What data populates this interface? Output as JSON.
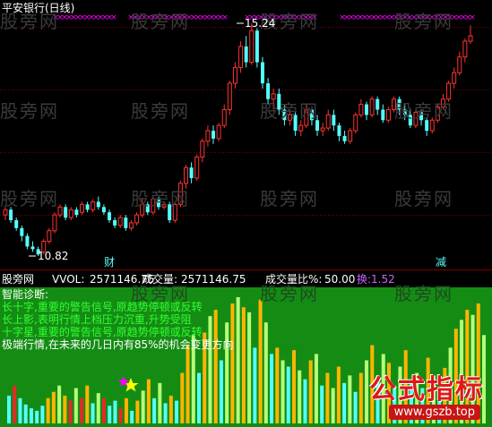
{
  "main_panel": {
    "title": "平安银行(日线)",
    "high_label": "15.24",
    "low_label": "10.82",
    "marker_cai": "财",
    "marker_jian": "减"
  },
  "volume_header": {
    "source": "股旁网",
    "vol_label": "VVOL:",
    "vol_value": "2571146.75",
    "cjl_label": "成交量:",
    "cjl_value": "2571146.75",
    "ratio_label": "成交量比%:",
    "ratio_value": "50.00",
    "huan_label": "换:",
    "huan_value": "1.52"
  },
  "diagnosis": {
    "title": "智能诊断:",
    "lines": [
      "长十字,重要的警告信号,原趋势停顿或反转",
      "长上影,表明行情上档压力沉重,升势受阻",
      "十字星,重要的警告信号,原趋势停顿或反转",
      "极端行情,在未来的几日内有85%的机会变更方向"
    ]
  },
  "watermark": "股旁网",
  "logo": {
    "text": "公式指标",
    "url": "www.gszb.top"
  },
  "colors": {
    "up": "#ff3232",
    "down": "#54ffff",
    "grid": "#7a0000",
    "marker_x": "#ff00ff",
    "vol_bg": "#148c14",
    "vol_up": "#ffb400",
    "vol_light": "#b4ff78",
    "vol_down": "#54ffff",
    "vol_red": "#e62828",
    "diag_green": "#32ff32",
    "purple": "#c864ff"
  },
  "chart_data": {
    "type": "candlestick",
    "symbol": "平安银行",
    "period": "日线",
    "max_price": 15.24,
    "min_price": 10.82,
    "candles": [
      [
        11.6,
        11.7,
        11.75,
        11.5
      ],
      [
        11.7,
        11.5,
        11.75,
        11.45
      ],
      [
        11.5,
        11.35,
        11.55,
        11.3
      ],
      [
        11.35,
        11.2,
        11.4,
        11.1
      ],
      [
        11.2,
        11.0,
        11.25,
        10.95
      ],
      [
        11.0,
        10.95,
        11.1,
        10.9
      ],
      [
        10.95,
        10.85,
        11.0,
        10.82
      ],
      [
        10.9,
        11.1,
        11.15,
        10.85
      ],
      [
        11.1,
        11.3,
        11.35,
        11.05
      ],
      [
        11.3,
        11.6,
        11.65,
        11.25
      ],
      [
        11.6,
        11.75,
        11.8,
        11.55
      ],
      [
        11.75,
        11.55,
        11.8,
        11.5
      ],
      [
        11.55,
        11.7,
        11.75,
        11.5
      ],
      [
        11.7,
        11.6,
        11.75,
        11.55
      ],
      [
        11.65,
        11.8,
        11.85,
        11.6
      ],
      [
        11.8,
        11.7,
        11.85,
        11.65
      ],
      [
        11.7,
        11.85,
        11.9,
        11.65
      ],
      [
        11.85,
        11.75,
        11.95,
        11.7
      ],
      [
        11.75,
        11.65,
        11.8,
        11.6
      ],
      [
        11.65,
        11.5,
        11.7,
        11.45
      ],
      [
        11.5,
        11.4,
        11.55,
        11.35
      ],
      [
        11.4,
        11.55,
        11.6,
        11.35
      ],
      [
        11.55,
        11.35,
        11.6,
        11.3
      ],
      [
        11.35,
        11.45,
        11.5,
        11.3
      ],
      [
        11.45,
        11.6,
        11.65,
        11.4
      ],
      [
        11.6,
        11.8,
        11.9,
        11.55
      ],
      [
        11.8,
        11.65,
        11.85,
        11.6
      ],
      [
        11.65,
        11.9,
        11.95,
        11.6
      ],
      [
        11.9,
        11.75,
        11.95,
        11.7
      ],
      [
        11.75,
        11.8,
        11.85,
        11.7
      ],
      [
        11.8,
        11.5,
        11.85,
        11.45
      ],
      [
        11.5,
        11.8,
        11.85,
        11.45
      ],
      [
        11.8,
        12.2,
        12.25,
        11.75
      ],
      [
        12.2,
        12.5,
        12.55,
        12.1
      ],
      [
        12.5,
        12.3,
        12.6,
        12.2
      ],
      [
        12.3,
        12.7,
        12.75,
        12.25
      ],
      [
        12.7,
        13.0,
        13.05,
        12.6
      ],
      [
        13.0,
        13.2,
        13.3,
        12.9
      ],
      [
        13.2,
        13.05,
        13.3,
        12.95
      ],
      [
        13.05,
        13.3,
        13.35,
        13.0
      ],
      [
        13.3,
        13.6,
        13.7,
        13.25
      ],
      [
        13.6,
        14.1,
        14.15,
        13.5
      ],
      [
        14.1,
        14.4,
        14.5,
        14.0
      ],
      [
        14.4,
        14.8,
        14.9,
        14.3
      ],
      [
        14.8,
        14.5,
        15.0,
        14.4
      ],
      [
        14.5,
        15.1,
        15.24,
        14.45
      ],
      [
        15.1,
        14.5,
        15.15,
        14.4
      ],
      [
        14.5,
        14.1,
        14.6,
        14.0
      ],
      [
        14.1,
        13.8,
        14.2,
        13.7
      ],
      [
        13.8,
        13.9,
        14.0,
        13.6
      ],
      [
        13.9,
        13.6,
        14.0,
        13.5
      ],
      [
        13.6,
        13.4,
        13.7,
        13.3
      ],
      [
        13.4,
        13.5,
        13.6,
        13.3
      ],
      [
        13.5,
        13.2,
        13.55,
        13.1
      ],
      [
        13.2,
        13.3,
        13.4,
        13.1
      ],
      [
        13.3,
        13.6,
        13.7,
        13.25
      ],
      [
        13.6,
        13.4,
        13.65,
        13.3
      ],
      [
        13.4,
        13.2,
        13.5,
        13.1
      ],
      [
        13.2,
        13.25,
        13.35,
        13.1
      ],
      [
        13.25,
        13.5,
        13.6,
        13.2
      ],
      [
        13.5,
        13.3,
        13.6,
        13.2
      ],
      [
        13.3,
        13.1,
        13.35,
        13.0
      ],
      [
        13.1,
        13.0,
        13.2,
        12.95
      ],
      [
        13.0,
        13.2,
        13.25,
        12.95
      ],
      [
        13.2,
        13.5,
        13.55,
        13.15
      ],
      [
        13.5,
        13.7,
        13.8,
        13.45
      ],
      [
        13.7,
        13.5,
        13.75,
        13.4
      ],
      [
        13.5,
        13.8,
        13.85,
        13.45
      ],
      [
        13.8,
        13.6,
        13.85,
        13.5
      ],
      [
        13.6,
        13.4,
        13.7,
        13.35
      ],
      [
        13.4,
        13.6,
        13.65,
        13.35
      ],
      [
        13.6,
        13.8,
        13.85,
        13.55
      ],
      [
        13.8,
        13.6,
        13.85,
        13.5
      ],
      [
        13.6,
        13.5,
        13.7,
        13.4
      ],
      [
        13.5,
        13.3,
        13.6,
        13.25
      ],
      [
        13.3,
        13.55,
        13.6,
        13.25
      ],
      [
        13.55,
        13.4,
        13.6,
        13.3
      ],
      [
        13.4,
        13.2,
        13.45,
        13.1
      ],
      [
        13.2,
        13.4,
        13.45,
        13.15
      ],
      [
        13.4,
        13.65,
        13.7,
        13.35
      ],
      [
        13.65,
        13.8,
        13.9,
        13.6
      ],
      [
        13.8,
        14.1,
        14.15,
        13.75
      ],
      [
        14.1,
        14.3,
        14.4,
        14.0
      ],
      [
        14.3,
        14.6,
        14.7,
        14.25
      ],
      [
        14.6,
        14.9,
        14.95,
        14.5
      ],
      [
        14.9,
        15.0,
        15.2,
        14.85
      ]
    ],
    "volumes": [
      [
        2,
        0.22
      ],
      [
        3,
        0.3
      ],
      [
        2,
        0.2
      ],
      [
        2,
        0.15
      ],
      [
        2,
        0.12
      ],
      [
        2,
        0.1
      ],
      [
        2,
        0.14
      ],
      [
        0,
        0.2
      ],
      [
        0,
        0.25
      ],
      [
        1,
        0.3
      ],
      [
        0,
        0.22
      ],
      [
        3,
        0.18
      ],
      [
        1,
        0.28
      ],
      [
        3,
        0.2
      ],
      [
        0,
        0.3
      ],
      [
        2,
        0.16
      ],
      [
        1,
        0.24
      ],
      [
        3,
        0.2
      ],
      [
        2,
        0.14
      ],
      [
        2,
        0.18
      ],
      [
        3,
        0.12
      ],
      [
        0,
        0.2
      ],
      [
        2,
        0.1
      ],
      [
        0,
        0.18
      ],
      [
        1,
        0.26
      ],
      [
        0,
        0.35
      ],
      [
        2,
        0.2
      ],
      [
        1,
        0.32
      ],
      [
        2,
        0.16
      ],
      [
        0,
        0.22
      ],
      [
        2,
        0.18
      ],
      [
        0,
        0.4
      ],
      [
        0,
        0.62
      ],
      [
        1,
        0.7
      ],
      [
        2,
        0.4
      ],
      [
        0,
        0.72
      ],
      [
        1,
        0.85
      ],
      [
        0,
        0.9
      ],
      [
        2,
        0.5
      ],
      [
        1,
        0.8
      ],
      [
        0,
        0.95
      ],
      [
        1,
        1.0
      ],
      [
        0,
        0.92
      ],
      [
        1,
        0.88
      ],
      [
        2,
        0.6
      ],
      [
        0,
        0.98
      ],
      [
        1,
        0.8
      ],
      [
        2,
        0.55
      ],
      [
        0,
        0.6
      ],
      [
        1,
        0.5
      ],
      [
        2,
        0.45
      ],
      [
        0,
        0.58
      ],
      [
        1,
        0.42
      ],
      [
        2,
        0.35
      ],
      [
        0,
        0.5
      ],
      [
        1,
        0.55
      ],
      [
        2,
        0.3
      ],
      [
        0,
        0.4
      ],
      [
        1,
        0.28
      ],
      [
        0,
        0.45
      ],
      [
        2,
        0.32
      ],
      [
        1,
        0.38
      ],
      [
        2,
        0.25
      ],
      [
        0,
        0.4
      ],
      [
        1,
        0.5
      ],
      [
        0,
        0.62
      ],
      [
        2,
        0.35
      ],
      [
        1,
        0.55
      ],
      [
        0,
        0.48
      ],
      [
        2,
        0.3
      ],
      [
        1,
        0.45
      ],
      [
        0,
        0.58
      ],
      [
        2,
        0.32
      ],
      [
        1,
        0.4
      ],
      [
        2,
        0.28
      ],
      [
        0,
        0.52
      ],
      [
        1,
        0.38
      ],
      [
        2,
        0.26
      ],
      [
        0,
        0.44
      ],
      [
        1,
        0.6
      ],
      [
        0,
        0.75
      ],
      [
        1,
        0.82
      ],
      [
        0,
        0.9
      ],
      [
        1,
        0.86
      ],
      [
        0,
        0.95
      ],
      [
        1,
        0.7
      ]
    ]
  }
}
